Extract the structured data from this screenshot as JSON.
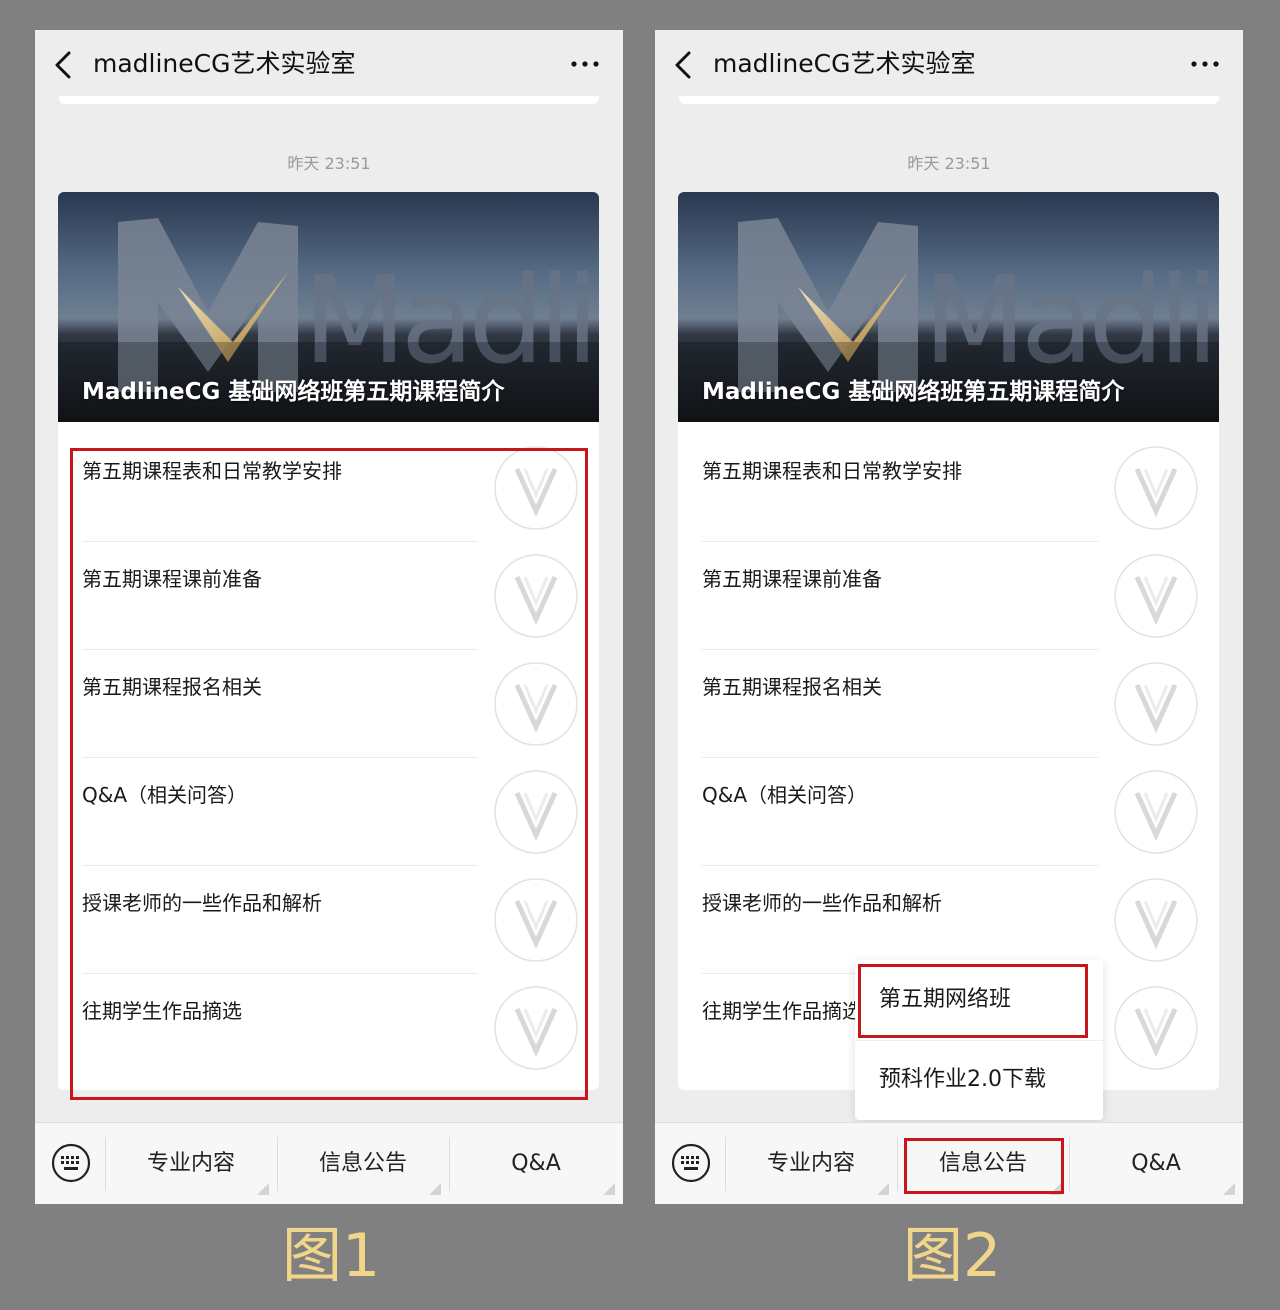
{
  "header": {
    "title": "madlineCG艺术实验室",
    "back_icon": "chevron-left-icon",
    "more_icon": "more-dots-icon"
  },
  "message": {
    "timestamp": "昨天 23:51",
    "banner_title": "MadlineCG 基础网络班第五期课程简介",
    "banner_logo_text": "Madline",
    "items": [
      {
        "label": "第五期课程表和日常教学安排"
      },
      {
        "label": "第五期课程课前准备"
      },
      {
        "label": "第五期课程报名相关"
      },
      {
        "label": "Q&A（相关问答）"
      },
      {
        "label": "授课老师的一些作品和解析"
      },
      {
        "label": "往期学生作品摘选"
      }
    ]
  },
  "menu": {
    "keyboard_icon": "keyboard-icon",
    "tabs": [
      {
        "label": "专业内容"
      },
      {
        "label": "信息公告"
      },
      {
        "label": "Q&A"
      }
    ],
    "popup_items": [
      {
        "label": "第五期网络班"
      },
      {
        "label": "预科作业2.0下载"
      }
    ]
  },
  "captions": {
    "figure1": "图1",
    "figure2": "图2"
  },
  "colors": {
    "highlight": "#c8161d",
    "caption": "#f0d68a",
    "background": "#808080"
  }
}
